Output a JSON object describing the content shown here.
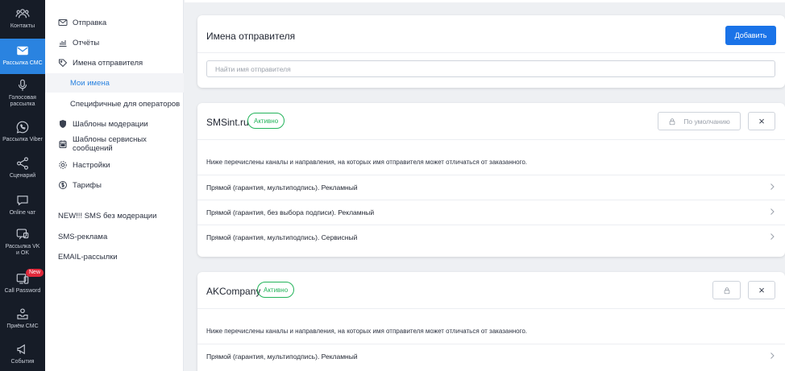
{
  "rail": {
    "items": [
      {
        "label": "Контакты"
      },
      {
        "label": "Рассылка СМС"
      },
      {
        "label": "Голосовая рассылка"
      },
      {
        "label": "Рассылка Viber"
      },
      {
        "label": "Сценарий"
      },
      {
        "label": "Online чат"
      },
      {
        "label": "Рассылка VK и OK"
      },
      {
        "label": "Call Password",
        "badge": "New"
      },
      {
        "label": "Приём СМС"
      },
      {
        "label": "События"
      }
    ]
  },
  "subnav": {
    "items": [
      {
        "label": "Отправка"
      },
      {
        "label": "Отчёты"
      },
      {
        "label": "Имена отправителя"
      },
      {
        "label": "Мои имена"
      },
      {
        "label": "Специфичные для операторов"
      },
      {
        "label": "Шаблоны модерации"
      },
      {
        "label": "Шаблоны сервисных сообщений"
      },
      {
        "label": "Настройки"
      },
      {
        "label": "Тарифы"
      },
      {
        "label": "NEW!!! SMS без модерации"
      },
      {
        "label": "SMS-реклама"
      },
      {
        "label": "EMAIL-рассылки"
      }
    ]
  },
  "header_card": {
    "title": "Имена отправителя",
    "add_label": "Добавить",
    "search_placeholder": "Найти имя отправителя"
  },
  "senders": [
    {
      "name": "SMSint.ru",
      "status": "Активно",
      "default_label": "По умолчанию",
      "close_label": "×",
      "description": "Ниже перечислены каналы и направления, на которых имя отправителя может отличаться от заказанного.",
      "rows": [
        "Прямой (гарантия, мультиподпись). Рекламный",
        "Прямой (гарантия, без выбора подписи). Рекламный",
        "Прямой (гарантия, мультиподпись). Сервисный"
      ]
    },
    {
      "name": "AKCompany",
      "status": "Активно",
      "close_label": "×",
      "description": "Ниже перечислены каналы и направления, на которых имя отправителя может отличаться от заказанного.",
      "rows": [
        "Прямой (гарантия, мультиподпись). Рекламный"
      ]
    }
  ],
  "colors": {
    "rail_bg": "#161c27",
    "rail_active": "#2a83e0",
    "primary_button": "#1a73e8",
    "status_green": "#23b35a",
    "active_nav_text": "#2a83e0"
  }
}
